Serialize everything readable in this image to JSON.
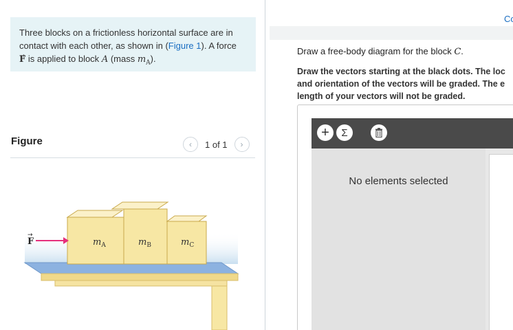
{
  "problem": {
    "text_1": "Three blocks on a frictionless horizontal surface are in",
    "text_2a": "contact with each other, as shown in (",
    "figure_link": "Figure 1",
    "text_2b": "). A force",
    "force_symbol": "F",
    "text_3a": " is applied to block ",
    "block_symbol": "A",
    "text_3b": " (mass ",
    "mass_symbol": "mA",
    "text_3c": ")."
  },
  "figure": {
    "label": "Figure",
    "pager_text": "1 of 1",
    "prev_icon": "chevron-left-icon",
    "next_icon": "chevron-right-icon",
    "force_label": "F",
    "block_labels": [
      "mA",
      "mB",
      "mC"
    ],
    "colors": {
      "block_face": "#f7e7a4",
      "block_top": "#fbf1c9",
      "block_side": "#eed98a",
      "table_top": "#8cb2e0",
      "table_edge": "#f0d98a",
      "arrow": "#e6307c",
      "surface_glow": "#cfe3f2"
    }
  },
  "right": {
    "corner_text": "Co",
    "instruction_a": "Draw a free-body diagram for the block ",
    "instruction_sym": "C",
    "instruction_b": ".",
    "note_1": "Draw the vectors starting at the black dots. The loc",
    "note_2": "and orientation of the vectors will be graded. The e",
    "note_3": "length of your vectors will not be graded.",
    "tools": {
      "add_icon": "plus-icon",
      "add_glyph": "+",
      "sum_icon": "sigma-icon",
      "sum_glyph": "Σ",
      "delete_icon": "trash-icon"
    },
    "no_selection": "No elements selected"
  },
  "colors": {
    "accent": "#1a6ec2",
    "problem_bg": "#e6f3f6",
    "toolbar_bg": "#4a4a4a",
    "panel_bg": "#e2e2e2"
  }
}
